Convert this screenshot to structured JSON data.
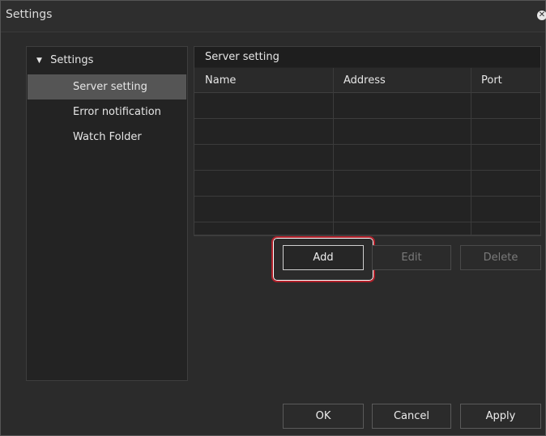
{
  "window": {
    "title": "Settings"
  },
  "sidebar": {
    "root_label": "Settings",
    "items": [
      {
        "label": "Server setting"
      },
      {
        "label": "Error notification"
      },
      {
        "label": "Watch Folder"
      }
    ]
  },
  "panel": {
    "title": "Server setting",
    "columns": [
      "Name",
      "Address",
      "Port"
    ]
  },
  "buttons": {
    "add": "Add",
    "edit": "Edit",
    "delete": "Delete",
    "ok": "OK",
    "cancel": "Cancel",
    "apply": "Apply"
  }
}
